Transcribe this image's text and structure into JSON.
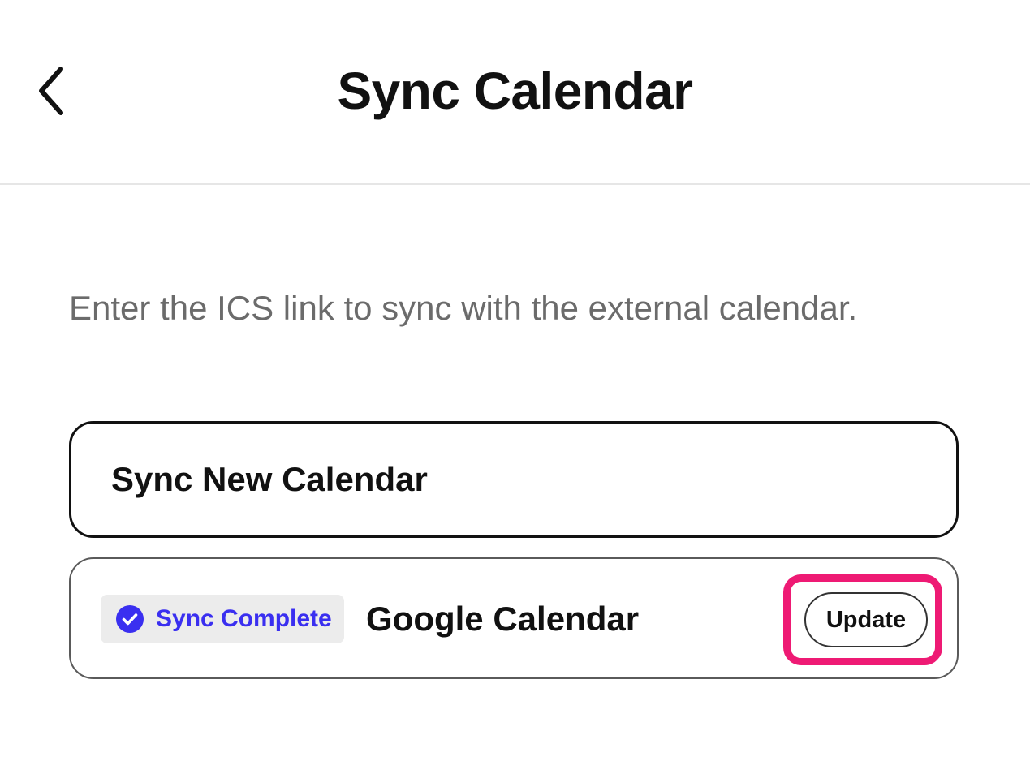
{
  "header": {
    "title": "Sync Calendar",
    "back_icon": "chevron-left-icon"
  },
  "description": "Enter the ICS link to sync with the external calendar.",
  "sync_new_button": {
    "label": "Sync New Calendar"
  },
  "calendars": [
    {
      "status": "Sync Complete",
      "status_icon": "check-circle-icon",
      "name": "Google Calendar",
      "action_label": "Update"
    }
  ],
  "colors": {
    "status_accent": "#3a2ff0",
    "status_badge_bg": "#ececec",
    "highlight": "#ee1a74"
  }
}
